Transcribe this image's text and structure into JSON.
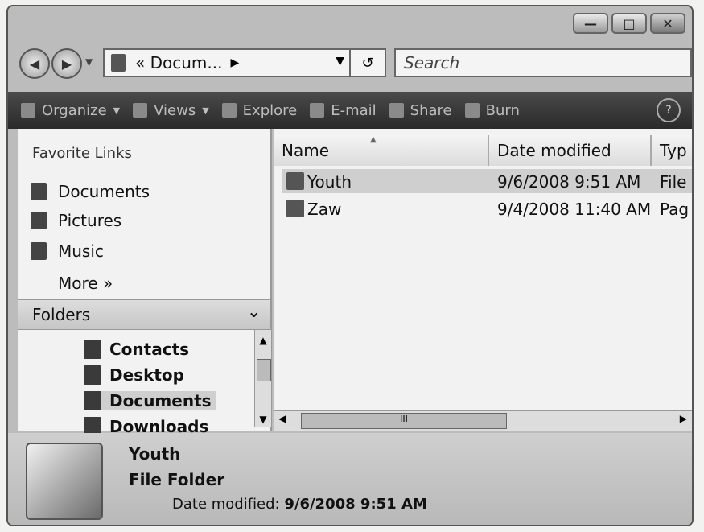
{
  "window": {
    "min_label": "—",
    "max_label": "□",
    "close_label": "✕"
  },
  "nav": {
    "back_icon": "◀",
    "forward_icon": "▶",
    "dropdown_icon": "▼"
  },
  "address": {
    "prefix": "«",
    "path": "Docum...",
    "arrow": "▶",
    "dropdown": "▼",
    "refresh": "↺"
  },
  "search": {
    "placeholder": "Search"
  },
  "toolbar": {
    "organize": "Organize",
    "views": "Views",
    "explore": "Explore",
    "email": "E-mail",
    "share": "Share",
    "burn": "Burn",
    "help": "?"
  },
  "sidebar": {
    "favorites_title": "Favorite Links",
    "favorites": [
      {
        "label": "Documents"
      },
      {
        "label": "Pictures"
      },
      {
        "label": "Music"
      }
    ],
    "more": "More »",
    "folders_title": "Folders",
    "folders": [
      {
        "label": "Contacts"
      },
      {
        "label": "Desktop"
      },
      {
        "label": "Documents"
      },
      {
        "label": "Downloads"
      }
    ]
  },
  "file_list": {
    "columns": [
      "Name",
      "Date modified",
      "Typ"
    ],
    "rows": [
      {
        "name": "Youth",
        "date": "9/6/2008 9:51 AM",
        "type": "File",
        "selected": true
      },
      {
        "name": "Zaw",
        "date": "9/4/2008 11:40 AM",
        "type": "Pag",
        "selected": false
      }
    ],
    "scroll_thumb": "III"
  },
  "details": {
    "name": "Youth",
    "type": "File Folder",
    "date_label": "Date modified:",
    "date_value": "9/6/2008 9:51 AM"
  }
}
